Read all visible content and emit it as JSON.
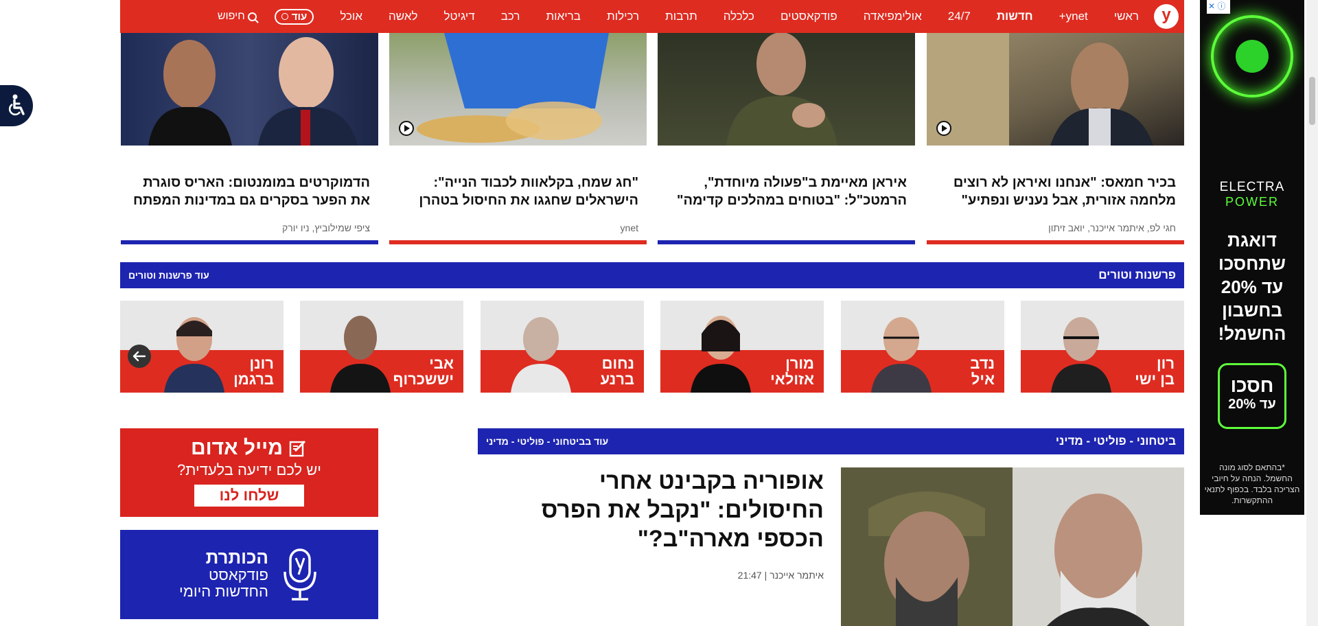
{
  "nav": {
    "logo": "y",
    "items": [
      "ראשי",
      "ynet+",
      "חדשות",
      "24/7",
      "אולימפיאדה",
      "פודקאסטים",
      "כלכלה",
      "תרבות",
      "רכילות",
      "בריאות",
      "רכב",
      "דיגיטל",
      "לאשה",
      "אוכל"
    ],
    "more": "עוד",
    "search": "חיפוש"
  },
  "stories": [
    {
      "title": "בכיר חמאס: \"אנחנו ואיראן לא רוצים מלחמה אזורית, אבל נעניש ונפתיע\"",
      "byline": "חגי לפ, איתמר אייכנר, יואב זיתון",
      "video": true,
      "accent": "#de2c21"
    },
    {
      "title": "איראן מאיימת ב\"פעולה מיוחדת\", הרמטכ\"ל: \"בטוחים במהלכים קדימה\"",
      "byline": "",
      "video": false,
      "accent": "#1d24b0"
    },
    {
      "title": "\"חג שמח, בקלאוות לכבוד הנייה\": הישראלים שחגגו את החיסול בטהרן",
      "byline": "ynet",
      "video": true,
      "accent": "#de2c21"
    },
    {
      "title": "הדמוקרטים במומנטום: האריס סוגרת את הפער בסקרים גם במדינות המפתח",
      "byline": "ציפי שמילוביץ, ניו יורק",
      "video": false,
      "accent": "#1d24b0"
    }
  ],
  "opinion": {
    "title": "פרשנות וטורים",
    "more": "עוד פרשנות וטורים",
    "columnists": [
      {
        "line1": "רון",
        "line2": "בן ישי"
      },
      {
        "line1": "נדב",
        "line2": "איל"
      },
      {
        "line1": "מורן",
        "line2": "אזולאי"
      },
      {
        "line1": "נחום",
        "line2": "ברנע"
      },
      {
        "line1": "אבי",
        "line2": "יששכרוף"
      },
      {
        "line1": "רונן",
        "line2": "ברגמן"
      }
    ]
  },
  "security": {
    "title": "ביטחוני - פוליטי - מדיני",
    "more": "עוד בביטחוני - פוליטי - מדיני",
    "main_title": "אופוריה בקבינט אחרי החיסולים: \"נקבל את הפרס הכספי מארה\"ב?\"",
    "author": "איתמר אייכנר",
    "time": "21:47"
  },
  "red_mail": {
    "title": "מייל אדום",
    "question": "יש לכם ידיעה בלעדית?",
    "button": "שלחו לנו"
  },
  "podcast": {
    "title": "הכותרת",
    "line2": "פודקאסט",
    "line3": "החדשות היומי"
  },
  "ad": {
    "brand": "ELECTRA",
    "brand2": "POWER",
    "headline1": "דואגת",
    "headline2": "שתחסכו",
    "headline3": "עד 20%",
    "headline4": "בחשבון",
    "headline5": "החשמל!",
    "cta1": "חסכו",
    "cta2": "עד 20%",
    "fine": "*בהתאם לסוג מונה החשמל. הנחה על חיובי הצריכה בלבד. בכפוף לתנאי ההתקשרות."
  },
  "colors": {
    "brand_red": "#de2c21",
    "brand_blue": "#1d24b0",
    "ad_green": "#5dff3a"
  }
}
